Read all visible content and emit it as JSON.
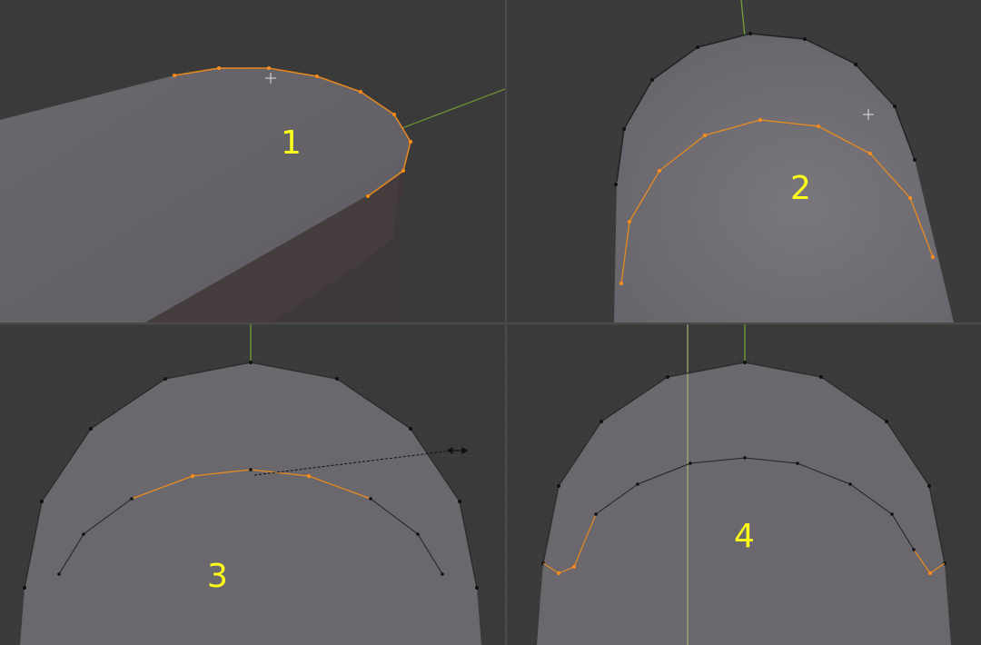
{
  "panels": [
    {
      "id": "viewport-1",
      "label": "1"
    },
    {
      "id": "viewport-2",
      "label": "2"
    },
    {
      "id": "viewport-3",
      "label": "3"
    },
    {
      "id": "viewport-4",
      "label": "4"
    }
  ],
  "colors": {
    "background": "#3a3a3a",
    "mesh_face": "#6b696e",
    "selected_edge": "#e88a1f",
    "vertex_dark": "#111111",
    "y_axis": "#7aa63a",
    "label": "#ffff1a",
    "grid": "#444444"
  },
  "icons": {
    "cursor": "crosshair-cursor-icon",
    "slide_arrow": "double-arrow-icon"
  }
}
